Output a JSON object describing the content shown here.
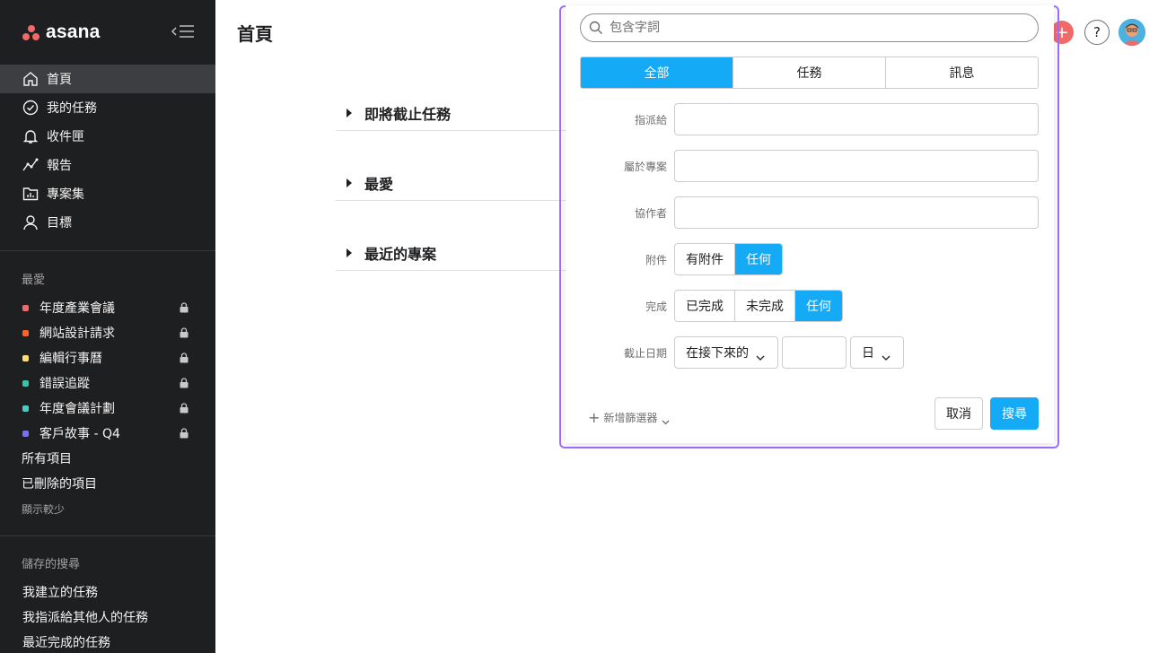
{
  "sidebar": {
    "logo_text": "asana",
    "nav": [
      {
        "label": "首頁",
        "icon": "home-icon",
        "active": true
      },
      {
        "label": "我的任務",
        "icon": "check-circle-icon"
      },
      {
        "label": "收件匣",
        "icon": "bell-icon"
      },
      {
        "label": "報告",
        "icon": "line-chart-icon"
      },
      {
        "label": "專案集",
        "icon": "portfolio-icon"
      },
      {
        "label": "目標",
        "icon": "person-icon"
      }
    ],
    "favorites_title": "最愛",
    "favorites": [
      {
        "label": "年度產業會議",
        "color": "#f06a6a"
      },
      {
        "label": "網站設計請求",
        "color": "#fd612c"
      },
      {
        "label": "編輯行事曆",
        "color": "#f8df72"
      },
      {
        "label": "錯誤追蹤",
        "color": "#37c5ab"
      },
      {
        "label": "年度會議計劃",
        "color": "#4ecbc4"
      },
      {
        "label": "客戶故事 - Q4",
        "color": "#7a6ff0"
      }
    ],
    "all_items": "所有項目",
    "deleted_items": "已刪除的項目",
    "show_less": "顯示較少",
    "saved_searches_title": "儲存的搜尋",
    "saved_searches": [
      "我建立的任務",
      "我指派給其他人的任務",
      "最近完成的任務"
    ]
  },
  "main": {
    "page_title": "首頁",
    "sections": [
      "即將截止任務",
      "最愛",
      "最近的專案"
    ]
  },
  "search": {
    "placeholder": "包含字詞",
    "tabs": [
      "全部",
      "任務",
      "訊息"
    ],
    "assignee_label": "指派給",
    "project_label": "屬於專案",
    "collaborator_label": "協作者",
    "attachment_label": "附件",
    "attachment_options": [
      "有附件",
      "任何"
    ],
    "completion_label": "完成",
    "completion_options": [
      "已完成",
      "未完成",
      "任何"
    ],
    "due_label": "截止日期",
    "due_range": "在接下來的",
    "due_unit": "日",
    "add_filter": "新增篩選器",
    "cancel": "取消",
    "submit": "搜尋"
  },
  "topbar": {
    "help": "?"
  },
  "colors": {
    "accent": "#14aaf5",
    "sidebar_bg": "#1e1f21",
    "outline": "#9d6eff"
  }
}
